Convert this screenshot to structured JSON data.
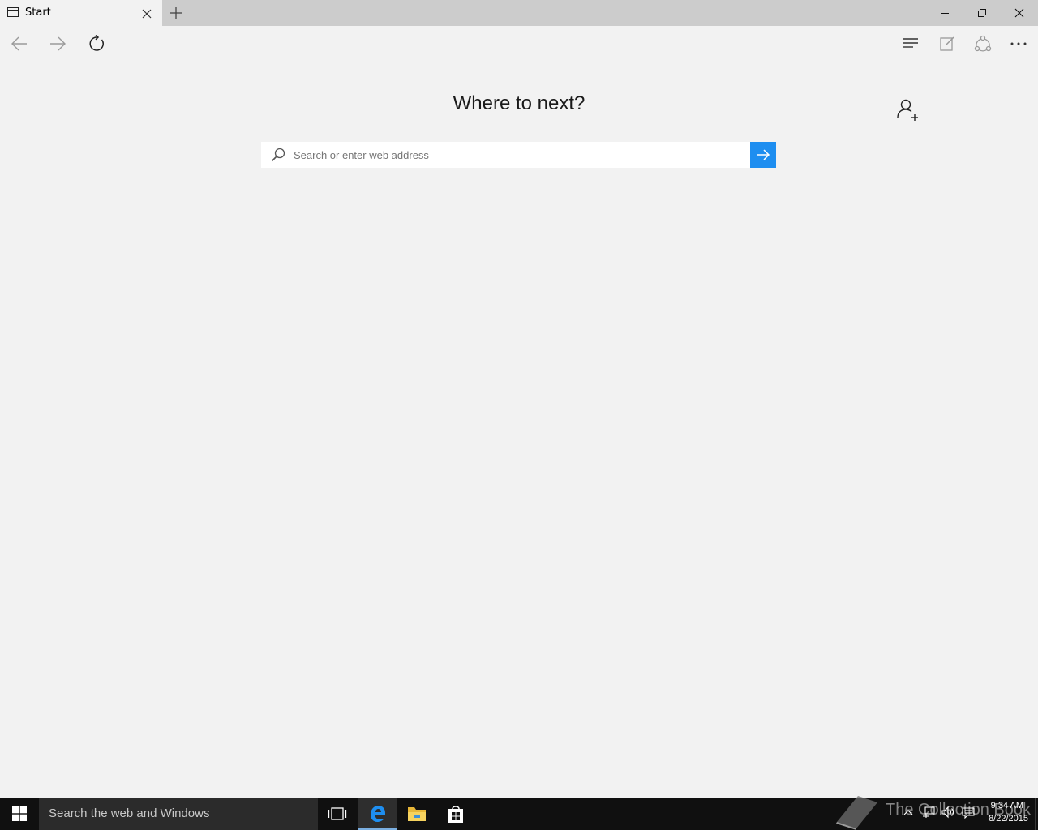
{
  "browser": {
    "tab": {
      "title": "Start"
    },
    "new_tab_icon": "plus-icon",
    "window_controls": [
      "minimize-icon",
      "restore-icon",
      "close-icon"
    ],
    "toolbar": {
      "left_icons": [
        "back-arrow-icon",
        "forward-arrow-icon",
        "refresh-icon"
      ],
      "right_icons": [
        "hub-icon",
        "web-note-icon",
        "share-icon",
        "more-icon"
      ]
    }
  },
  "start_page": {
    "heading": "Where to next?",
    "search_placeholder": "Search or enter web address",
    "search_value": "",
    "go_icon": "arrow-right-icon",
    "add_user_icon": "add-user-icon",
    "accent_color": "#1e8ef0"
  },
  "taskbar": {
    "search_text": "Search the web and Windows",
    "apps": [
      "task-view-icon",
      "edge-icon",
      "file-explorer-icon",
      "store-icon"
    ],
    "watermark": "The Collection Book",
    "clock": {
      "time": "9:34 AM",
      "date": "8/22/2015"
    }
  }
}
